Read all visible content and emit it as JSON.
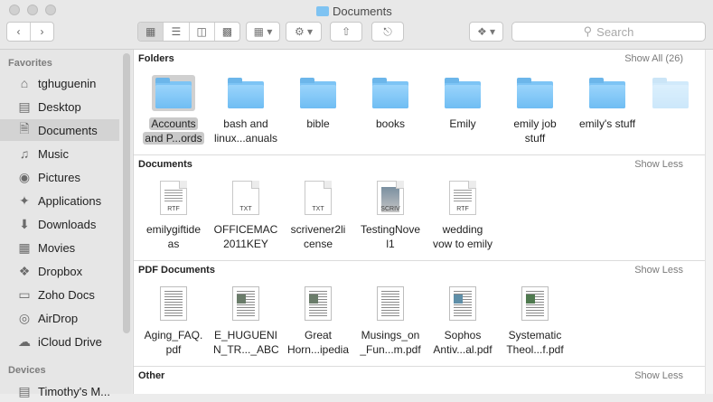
{
  "window": {
    "title": "Documents"
  },
  "search": {
    "placeholder": "Search"
  },
  "sidebar": {
    "favorites_label": "Favorites",
    "devices_label": "Devices",
    "items": [
      {
        "label": "tghuguenin",
        "icon": "home-icon"
      },
      {
        "label": "Desktop",
        "icon": "desktop-icon"
      },
      {
        "label": "Documents",
        "icon": "documents-icon",
        "active": true
      },
      {
        "label": "Music",
        "icon": "music-icon"
      },
      {
        "label": "Pictures",
        "icon": "camera-icon"
      },
      {
        "label": "Applications",
        "icon": "applications-icon"
      },
      {
        "label": "Downloads",
        "icon": "downloads-icon"
      },
      {
        "label": "Movies",
        "icon": "movies-icon"
      },
      {
        "label": "Dropbox",
        "icon": "dropbox-icon"
      },
      {
        "label": "Zoho Docs",
        "icon": "folder-icon"
      },
      {
        "label": "AirDrop",
        "icon": "airdrop-icon"
      },
      {
        "label": "iCloud Drive",
        "icon": "cloud-icon"
      }
    ],
    "devices": [
      {
        "label": "Timothy's M..."
      }
    ]
  },
  "sections": {
    "folders": {
      "title": "Folders",
      "link": "Show All (26)",
      "items": [
        {
          "line1": "Accounts",
          "line2": "and P...ords"
        },
        {
          "line1": "bash and",
          "line2": "linux...anuals"
        },
        {
          "line1": "bible",
          "line2": ""
        },
        {
          "line1": "books",
          "line2": ""
        },
        {
          "line1": "Emily",
          "line2": ""
        },
        {
          "line1": "emily job",
          "line2": "stuff"
        },
        {
          "line1": "emily's stuff",
          "line2": ""
        }
      ]
    },
    "documents": {
      "title": "Documents",
      "link": "Show Less",
      "items": [
        {
          "line1": "emilygiftide",
          "line2": "as",
          "tag": "RTF"
        },
        {
          "line1": "OFFICEMAC",
          "line2": "2011KEY",
          "tag": "TXT"
        },
        {
          "line1": "scrivener2li",
          "line2": "cense",
          "tag": "TXT"
        },
        {
          "line1": "TestingNove",
          "line2": "l1",
          "tag": "SCRIV"
        },
        {
          "line1": "wedding",
          "line2": "vow to emily",
          "tag": "RTF"
        }
      ]
    },
    "pdf": {
      "title": "PDF Documents",
      "link": "Show Less",
      "items": [
        {
          "line1": "Aging_FAQ.",
          "line2": "pdf"
        },
        {
          "line1": "E_HUGUENI",
          "line2": "N_TR..._ABC"
        },
        {
          "line1": "Great",
          "line2": "Horn...ipedia"
        },
        {
          "line1": "Musings_on",
          "line2": "_Fun...m.pdf"
        },
        {
          "line1": "Sophos",
          "line2": "Antiv...al.pdf"
        },
        {
          "line1": "Systematic",
          "line2": "Theol...f.pdf"
        }
      ]
    },
    "other": {
      "title": "Other",
      "link": "Show Less"
    }
  }
}
